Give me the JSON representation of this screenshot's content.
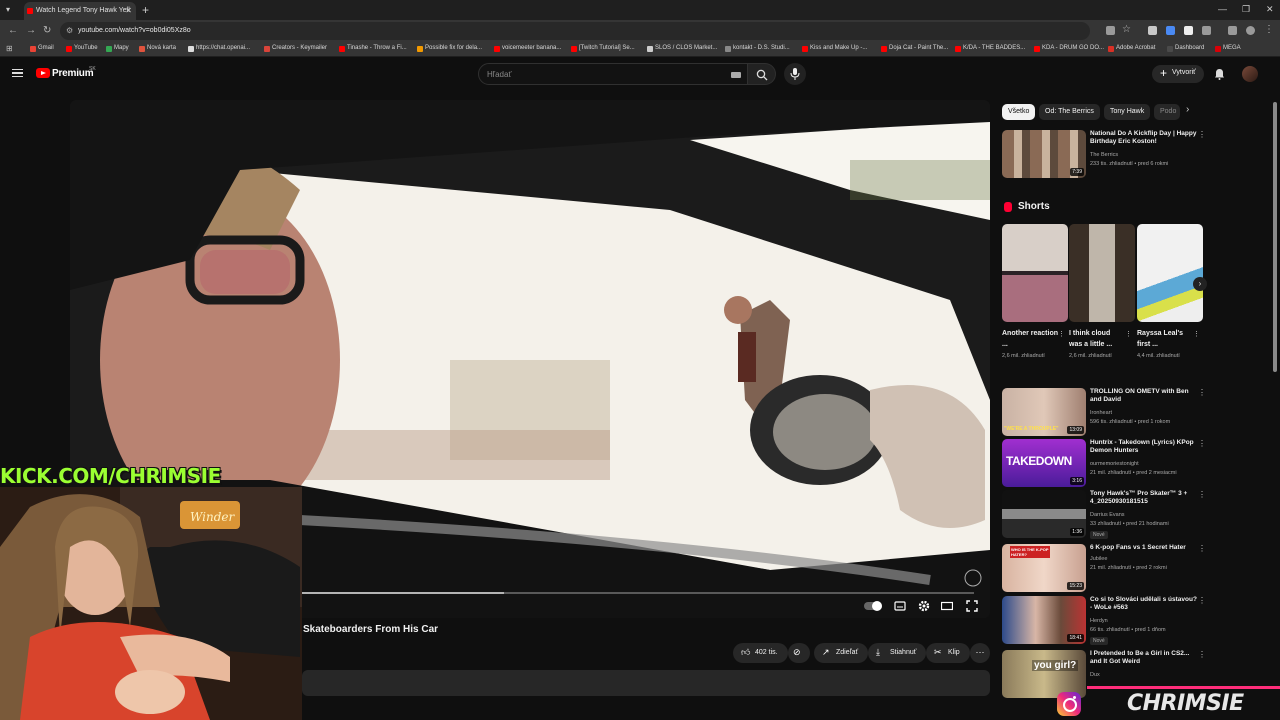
{
  "browser": {
    "tab_title": "Watch Legend Tony Hawk Yell",
    "url": "youtube.com/watch?v=ob0di05Xz8o",
    "bookmarks": [
      {
        "label": "Gmail",
        "color": "#ea4335"
      },
      {
        "label": "YouTube",
        "color": "#ff0000"
      },
      {
        "label": "Mapy",
        "color": "#34a853"
      },
      {
        "label": "Nová karta",
        "color": "#e0533d"
      },
      {
        "label": "https://chat.openai...",
        "color": "#dddddd"
      },
      {
        "label": "Creators - Keymailer",
        "color": "#d9443a"
      },
      {
        "label": "Tinashe - Throw a Fi...",
        "color": "#ff0000"
      },
      {
        "label": "Possible fix for dela...",
        "color": "#f29900"
      },
      {
        "label": "voicemeeter banana...",
        "color": "#ff0000"
      },
      {
        "label": "[Twitch Tutorial] Se...",
        "color": "#ff0000"
      },
      {
        "label": "SLOS / CLOS Market...",
        "color": "#cccccc"
      },
      {
        "label": "kontakt - D.S. Studi...",
        "color": "#888888"
      },
      {
        "label": "Kiss and Make Up -...",
        "color": "#ff0000"
      },
      {
        "label": "Doja Cat - Paint The...",
        "color": "#ff0000"
      },
      {
        "label": "K/DA - THE BADDES...",
        "color": "#ff0000"
      },
      {
        "label": "KDA - DRUM GO DO...",
        "color": "#ff0000"
      },
      {
        "label": "Adobe Acrobat",
        "color": "#d93025"
      },
      {
        "label": "Dashboard",
        "color": "#4a4a4a"
      },
      {
        "label": "MEGA",
        "color": "#d90007"
      }
    ]
  },
  "header": {
    "logo_text": "Premium",
    "logo_sup": "SK",
    "search_placeholder": "Hľadať",
    "create_label": "Vytvoriť"
  },
  "video": {
    "title": "Skateboarders From His Car",
    "progress_loaded": 0.3,
    "actions": {
      "likes": "402 tis.",
      "share": "Zdieľať",
      "download": "Stiahnuť",
      "clip": "Klip"
    }
  },
  "sidebar": {
    "chips": [
      "Všetko",
      "Od: The Berrics",
      "Tony Hawk",
      "Podo"
    ],
    "top_rec": {
      "title": "National Do A Kickflip Day | Happy Birthday Eric Koston!",
      "channel": "The Berrics",
      "meta": "233 tis. zhliadnutí • pred 6 rokmi",
      "duration": "7:39"
    },
    "shorts_heading": "Shorts",
    "shorts": [
      {
        "title": "Another reaction ...",
        "views": "2,6 mil. zhliadnutí"
      },
      {
        "title": "I think cloud was a little ...",
        "views": "2,6 mil. zhliadnutí"
      },
      {
        "title": "Rayssa Leal's first ...",
        "views": "4,4 mil. zhliadnutí"
      }
    ],
    "recs": [
      {
        "title": "TROLLING ON OMETV with Ben and David",
        "channel": "Ironheart",
        "meta": "596 tis. zhliadnutí • pred 1 rokom",
        "duration": "13:09",
        "badge": ""
      },
      {
        "title": "Huntrix - Takedown (Lyrics) KPop Demon Hunters",
        "channel": "ourmemoriestonight",
        "meta": "21 mil. zhliadnutí • pred 2 mesiacmi",
        "duration": "3:16",
        "badge": ""
      },
      {
        "title": "Tony Hawk's™ Pro Skater™ 3 + 4_20250930181515",
        "channel": "Darrius Evans",
        "meta": "33 zhliadnutí • pred 21 hodinami",
        "duration": "1:36",
        "badge": "Nové"
      },
      {
        "title": "6 K-pop Fans vs 1 Secret Hater",
        "channel": "Jubilee",
        "meta": "21 mil. zhliadnutí • pred 2 rokmi",
        "duration": "15:23",
        "badge": ""
      },
      {
        "title": "Co si to Slováci udělali s ústavou? - WoLe #563",
        "channel": "Herdyn",
        "meta": "66 tis. zhliadnutí • pred 1 dňom",
        "duration": "18:41",
        "badge": "Nové"
      },
      {
        "title": "I Pretended to Be a Girl in CS2... and It Got Weird",
        "channel": "Dux",
        "meta": "",
        "duration": "",
        "badge": ""
      }
    ]
  },
  "overlay": {
    "kick_text": "KICK.COM/CHRIMSIE",
    "ig_name": "CHRIMSIE",
    "neon_sign": "Winder"
  },
  "thumb_texts": {
    "takedown": "TAKEDOWN",
    "troll": "\"WE'RE A THROUPLE\"",
    "yougirl": "you girl?",
    "hater": "WHO IS THE K-POP HATER?"
  }
}
